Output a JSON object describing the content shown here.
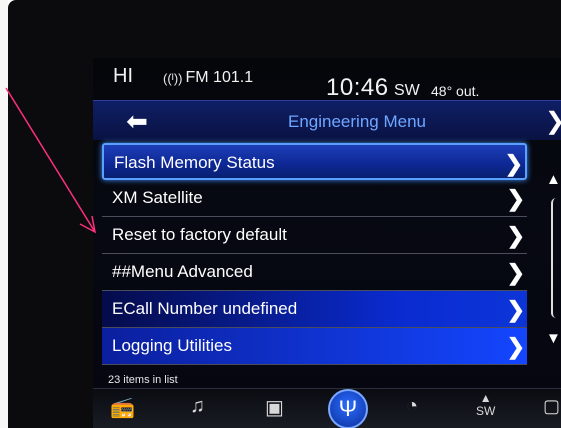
{
  "status": {
    "source_short": "HI",
    "radio": "FM 101.1",
    "time": "10:46",
    "direction": "SW",
    "temperature": "48° out."
  },
  "header": {
    "title": "Engineering Menu"
  },
  "menu": {
    "items": [
      {
        "label": "Flash Memory Status"
      },
      {
        "label": "XM Satellite"
      },
      {
        "label": "Reset to factory default"
      },
      {
        "label": "##Menu Advanced"
      },
      {
        "label": "ECall Number undefined"
      },
      {
        "label": "Logging Utilities"
      }
    ],
    "count_text": "23 items in list"
  },
  "bottom_bar": {
    "compass_label": "SW"
  },
  "icons": {
    "back": "back-arrow-icon",
    "close": "chevron-right-icon",
    "scroll_up": "triangle-up-icon",
    "scroll_down": "triangle-down-icon"
  },
  "colors": {
    "title_color": "#6fa6ff",
    "highlight": "#1446ff",
    "selected_border": "#5aa0ff",
    "annotation_arrow": "#ff2e7e"
  }
}
